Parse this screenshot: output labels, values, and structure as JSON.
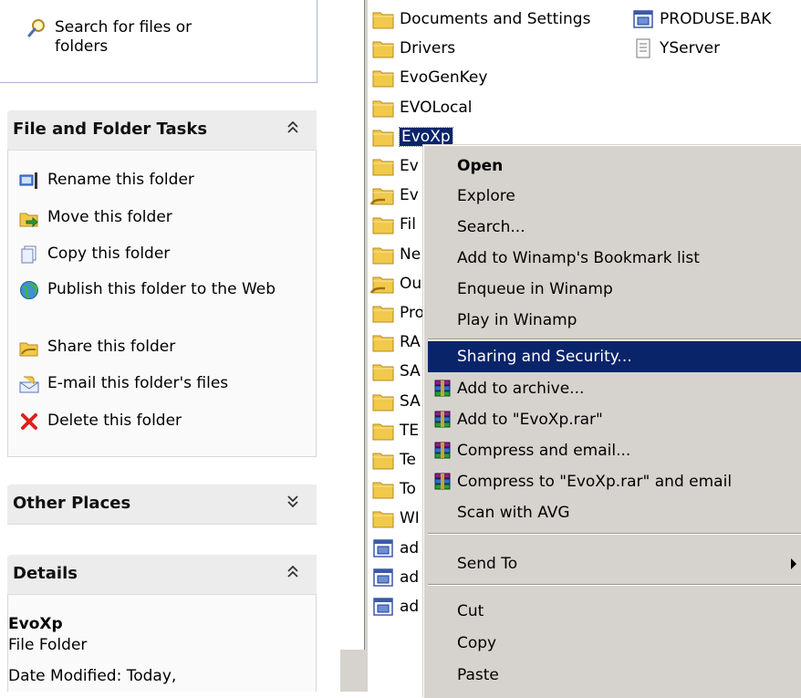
{
  "search_box": {
    "label": "Search for files or folders"
  },
  "tasks_section": {
    "title": "File and Folder Tasks",
    "items": [
      {
        "label": "Rename this folder",
        "icon": "rename-icon"
      },
      {
        "label": "Move this folder",
        "icon": "move-icon"
      },
      {
        "label": "Copy this folder",
        "icon": "copy-icon"
      },
      {
        "label": "Publish this folder to the Web",
        "icon": "globe-icon"
      },
      {
        "label": "Share this folder",
        "icon": "share-icon"
      },
      {
        "label": "E-mail this folder's files",
        "icon": "email-icon"
      },
      {
        "label": "Delete this folder",
        "icon": "delete-icon"
      }
    ]
  },
  "other_places": {
    "title": "Other Places"
  },
  "details": {
    "title": "Details",
    "name": "EvoXp",
    "type": "File Folder",
    "date_modified": "Date Modified: Today,"
  },
  "files": [
    {
      "name": "Documents and Settings",
      "kind": "folder"
    },
    {
      "name": "Drivers",
      "kind": "folder"
    },
    {
      "name": "EvoGenKey",
      "kind": "folder"
    },
    {
      "name": "EVOLocal",
      "kind": "folder"
    },
    {
      "name": "EvoXp",
      "kind": "folder"
    },
    {
      "name": "Ev",
      "kind": "folder"
    },
    {
      "name": "Ev",
      "kind": "folder-shared"
    },
    {
      "name": "Fil",
      "kind": "folder"
    },
    {
      "name": "Ne",
      "kind": "folder"
    },
    {
      "name": "Ou",
      "kind": "folder-shared"
    },
    {
      "name": "Pro",
      "kind": "folder"
    },
    {
      "name": "RA",
      "kind": "folder"
    },
    {
      "name": "SA",
      "kind": "folder"
    },
    {
      "name": "SA",
      "kind": "folder"
    },
    {
      "name": "TE",
      "kind": "folder"
    },
    {
      "name": "Te",
      "kind": "folder"
    },
    {
      "name": "To",
      "kind": "folder"
    },
    {
      "name": "WI",
      "kind": "folder"
    },
    {
      "name": "ad",
      "kind": "file"
    },
    {
      "name": "ad",
      "kind": "file"
    },
    {
      "name": "ad",
      "kind": "file"
    }
  ],
  "files_col2": [
    {
      "name": "PRODUSE.BAK",
      "kind": "file"
    },
    {
      "name": "YServer",
      "kind": "text"
    }
  ],
  "context_menu": {
    "items": [
      {
        "label": "Open",
        "bold": true
      },
      {
        "label": "Explore"
      },
      {
        "label": "Search..."
      },
      {
        "label": "Add to Winamp's Bookmark list"
      },
      {
        "label": "Enqueue in Winamp"
      },
      {
        "label": "Play in Winamp"
      },
      {
        "label": "Sharing and Security...",
        "highlighted": true
      },
      {
        "label": "Add to archive...",
        "icon": "winrar-icon"
      },
      {
        "label": "Add to \"EvoXp.rar\"",
        "icon": "winrar-icon"
      },
      {
        "label": "Compress and email...",
        "icon": "winrar-icon"
      },
      {
        "label": "Compress to \"EvoXp.rar\" and email",
        "icon": "winrar-icon"
      },
      {
        "label": "Scan with AVG"
      },
      {
        "label": "Send To",
        "submenu": true
      },
      {
        "label": "Cut"
      },
      {
        "label": "Copy"
      },
      {
        "label": "Paste"
      }
    ]
  },
  "colors": {
    "highlight": "#0a246a",
    "menu_bg": "#d6d3ce",
    "folder": "#f1c94b"
  }
}
